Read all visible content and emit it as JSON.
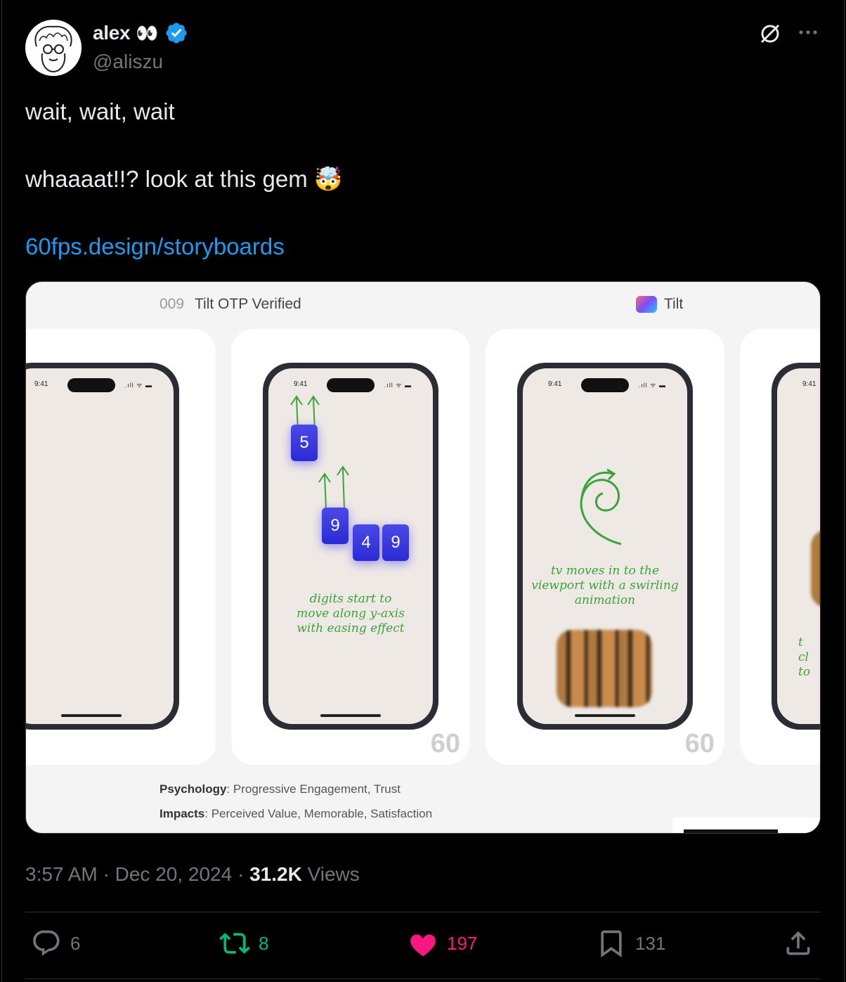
{
  "author": {
    "name": "alex",
    "name_emoji": "👀",
    "handle": "@aliszu"
  },
  "tweet": {
    "line1": "wait, wait, wait",
    "line2": "whaaaat!!? look at this gem",
    "line2_emoji": "🤯",
    "link": "60fps.design/storyboards"
  },
  "media": {
    "number": "009",
    "title": "Tilt OTP Verified",
    "app_name": "Tilt",
    "status_time": "9:41",
    "digits": [
      "5",
      "9",
      "4",
      "9"
    ],
    "note_digits": [
      "digits start to",
      "move along y-axis",
      "with easing effect"
    ],
    "note_tv": [
      "tv moves in to the",
      "viewport with a swirling",
      "animation"
    ],
    "note_partial": [
      "t",
      "cl",
      "to"
    ],
    "fps_label": "60",
    "psychology_label": "Psychology",
    "psychology_value": ": Progressive Engagement, Trust",
    "impacts_label": "Impacts",
    "impacts_value": ": Perceived Value, Memorable, Satisfaction"
  },
  "meta": {
    "time": "3:57 AM",
    "date": "Dec 20, 2024",
    "views_count": "31.2K",
    "views_label": "Views"
  },
  "actions": {
    "replies": "6",
    "reposts": "8",
    "likes": "197",
    "bookmarks": "131"
  },
  "colors": {
    "link": "#1d9bf0",
    "verified": "#1d9bf0",
    "repost": "#00ba7c",
    "like": "#f91880",
    "muted": "#71767b"
  }
}
